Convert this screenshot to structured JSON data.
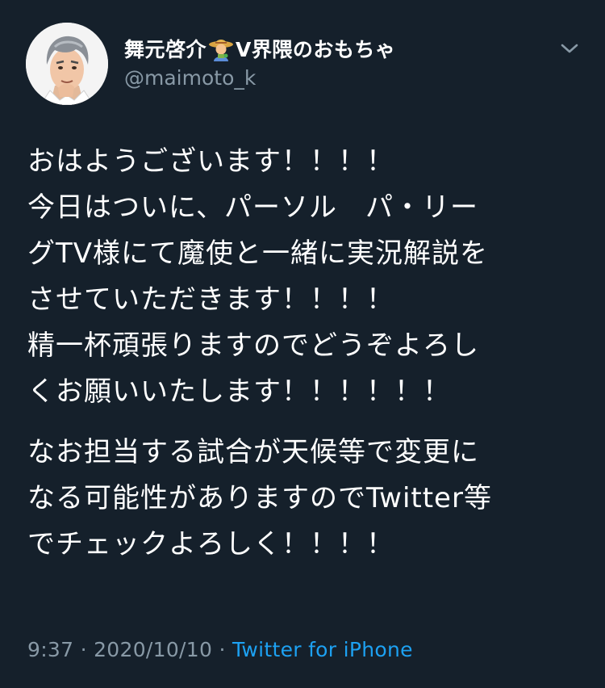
{
  "author": {
    "name_part1": "舞元啓介",
    "name_part2": "V界隈のおもちゃ",
    "emoji_icon": "farmer-emoji-icon",
    "handle": "@maimoto_k"
  },
  "tweet": {
    "paragraph1": [
      "おはようございます！！！！",
      "今日はついに、パーソル　パ・リー",
      "グTV様にて魔使と一緒に実況解説を",
      "させていただきます！！！！",
      "精一杯頑張りますのでどうぞよろし",
      "くお願いいたします！！！！！！"
    ],
    "paragraph2": [
      "なお担当する試合が天候等で変更に",
      "なる可能性がありますのでTwitter等",
      "でチェックよろしく！！！！"
    ]
  },
  "meta": {
    "time": "9:37",
    "separator1": "·",
    "date": "2020/10/10",
    "separator2": "·",
    "source": "Twitter for iPhone"
  },
  "colors": {
    "background": "#15202b",
    "text": "#ffffff",
    "secondary": "#8899a6",
    "link": "#1da1f2"
  }
}
